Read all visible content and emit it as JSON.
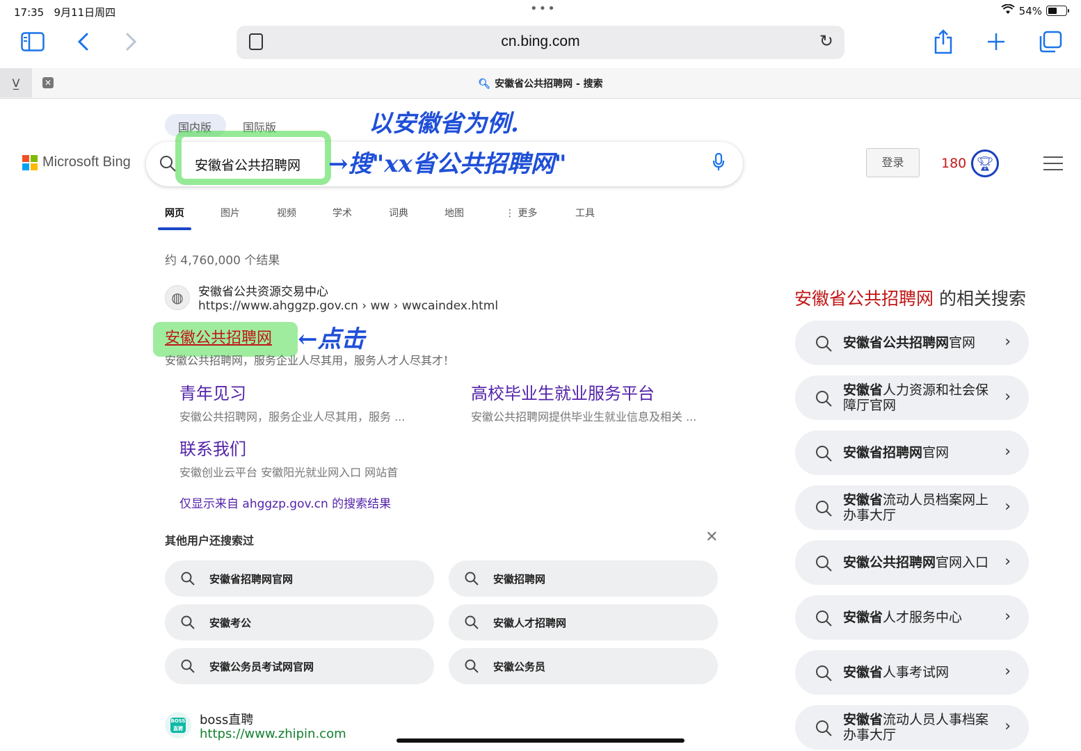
{
  "status": {
    "time": "17:35",
    "date": "9月11日周四",
    "battery": "54%",
    "battery_level": 0.54
  },
  "browser": {
    "url": "cn.bing.com",
    "tab_title": "安徽省公共招聘网 - 搜索"
  },
  "bing": {
    "scope_domestic": "国内版",
    "scope_intl": "国际版",
    "logo": "Microsoft Bing",
    "query": "安徽省公共招聘网",
    "login": "登录",
    "points": "180"
  },
  "tabs": [
    "网页",
    "图片",
    "视频",
    "学术",
    "词典",
    "地图",
    "更多",
    "工具"
  ],
  "result_count": "约 4,760,000 个结果",
  "result": {
    "site_name": "安徽省公共资源交易中心",
    "site_url": "https://www.ahggzp.gov.cn › ww › wwcaindex.html",
    "title": "安徽公共招聘网",
    "snippet": "安徽公共招聘网，服务企业人尽其用，服务人才人尽其才！",
    "sublinks": [
      {
        "title": "青年见习",
        "snippet": "安徽公共招聘网，服务企业人尽其用，服务 ..."
      },
      {
        "title": "高校毕业生就业服务平台",
        "snippet": "安徽公共招聘网提供毕业生就业信息及相关 ..."
      },
      {
        "title": "联系我们",
        "snippet": "安徽创业云平台 安徽阳光就业网入口 网站首"
      }
    ],
    "only_from": "仅显示来自 ahggzp.gov.cn 的搜索结果"
  },
  "others": {
    "heading": "其他用户还搜索过",
    "items": [
      "安徽省招聘网官网",
      "安徽招聘网",
      "安徽考公",
      "安徽人才招聘网",
      "安徽公务员考试网官网",
      "安徽公务员"
    ]
  },
  "boss": {
    "name": "boss直聘",
    "url": "https://www.zhipin.com",
    "icon_text": "BOSS直聘"
  },
  "related": {
    "heading_query": "安徽省公共招聘网",
    "heading_suffix": " 的相关搜索",
    "items": [
      {
        "bold": "安徽省公共招聘网",
        "rest": "官网"
      },
      {
        "bold": "安徽省",
        "rest": "人力资源和社会保障厅官网"
      },
      {
        "bold": "安徽省招聘网",
        "rest": "官网"
      },
      {
        "bold": "安徽省",
        "rest": "流动人员档案网上办事大厅"
      },
      {
        "bold": "安徽公共招聘网",
        "rest": "官网入口"
      },
      {
        "bold": "安徽省",
        "rest": "人才服务中心"
      },
      {
        "bold": "安徽省",
        "rest": "人事考试网"
      },
      {
        "bold": "安徽省",
        "rest": "流动人员人事档案办事大厅"
      }
    ]
  },
  "annotations": {
    "example": "以安徽省为例.",
    "search_hint": "→搜\"xx省公共招聘网\"",
    "click_hint": "←点击"
  },
  "colors": {
    "accent": "#1a47c8",
    "result_title": "#c01616",
    "visited_link": "#5323a9",
    "highlighter": "#50dc50",
    "annotation_ink": "#1f4fd8"
  },
  "icons": [
    "sidebar-icon",
    "back-icon",
    "forward-icon",
    "reader-icon",
    "reload-icon",
    "share-icon",
    "new-tab-icon",
    "tabs-icon",
    "search-icon",
    "mic-icon",
    "trophy-icon",
    "menu-icon",
    "globe-icon",
    "close-icon",
    "chevron-right-icon"
  ]
}
